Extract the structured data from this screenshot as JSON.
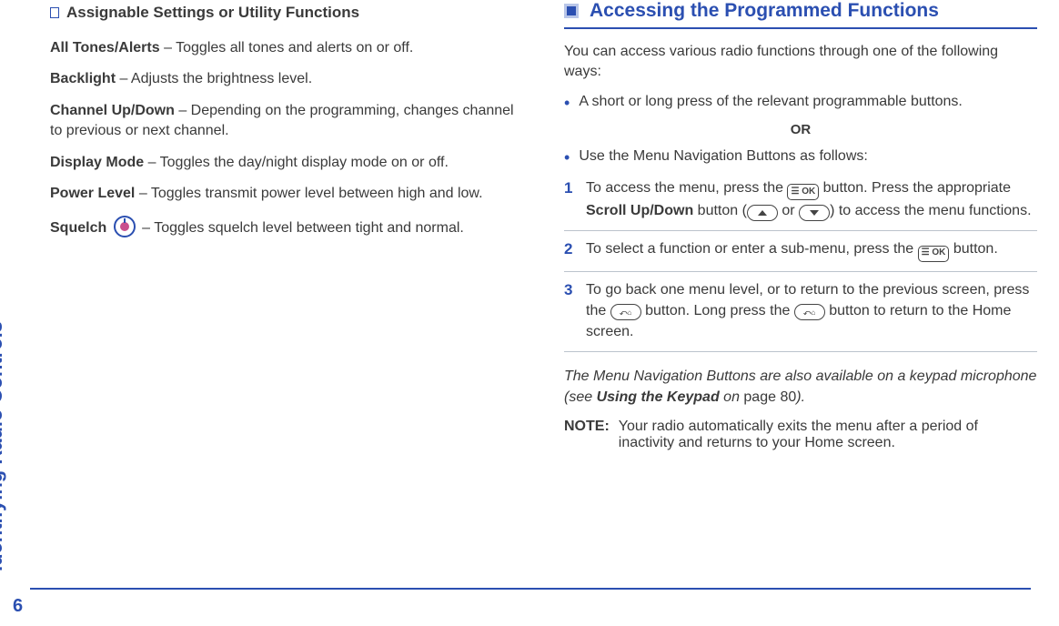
{
  "sidebar": {
    "label": "Identifying Radio Controls"
  },
  "page_number": "6",
  "left": {
    "subheading": "Assignable Settings or Utility Functions",
    "items": [
      {
        "term": "All Tones/Alerts",
        "desc": " – Toggles all tones and alerts on or off."
      },
      {
        "term": "Backlight",
        "desc": " – Adjusts the brightness level."
      },
      {
        "term": "Channel Up/Down",
        "desc": " – Depending on the programming, changes channel to previous or next channel."
      },
      {
        "term": "Display Mode",
        "desc": " – Toggles the day/night display mode on or off."
      },
      {
        "term": "Power Level",
        "desc": " – Toggles transmit power level between high and low."
      }
    ],
    "squelch_term": "Squelch",
    "squelch_desc": "  – Toggles squelch level between tight and normal."
  },
  "right": {
    "heading": "Accessing the Programmed Functions",
    "intro": "You can access various radio functions through one of the following ways:",
    "bullet1": "A short or long press of the relevant programmable buttons.",
    "or": "OR",
    "bullet2": "Use the Menu Navigation Buttons as follows:",
    "steps": {
      "s1a": "To access the menu, press the ",
      "s1b": " button. Press the appropriate ",
      "s1c": "Scroll Up/Down",
      "s1d": " button (",
      "s1e": " or ",
      "s1f": ") to access the menu functions.",
      "s2a": "To select a function or enter a sub-menu, press the ",
      "s2b": " button.",
      "s3a": "To go back one menu level, or to return to the previous screen, press the ",
      "s3b": " button. Long press the ",
      "s3c": " button to return to the Home screen."
    },
    "footnote_a": "The Menu Navigation Buttons are also available on a keypad microphone (see ",
    "footnote_b": "Using the Keypad",
    "footnote_c": " on ",
    "footnote_d": "page 80",
    "footnote_e": ").",
    "note_label": "NOTE:",
    "note_text": "Your radio automatically exits the menu after a period of inactivity and returns to your Home screen."
  }
}
